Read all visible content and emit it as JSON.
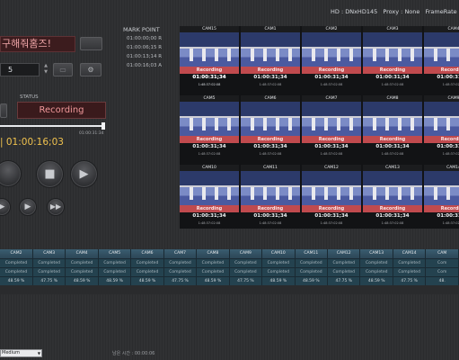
{
  "header": {
    "format": "HD : DNxHD145",
    "proxy": "Proxy : None",
    "framerate": "FrameRate : 60M"
  },
  "title_field": {
    "value": "구해줘홈즈!"
  },
  "count_field": {
    "value": "5"
  },
  "status": {
    "label": "STATUS",
    "value": "Recording"
  },
  "progress": {
    "fraction": 0.97,
    "time": "01:00:31:34"
  },
  "timecode": "| 01:00:16;03",
  "mark_point": {
    "title": "MARK POINT",
    "items": [
      "01:00:00;00 R",
      "01:00:06;15 R",
      "01:00:13;14 R",
      "01:00:16;03 A"
    ]
  },
  "cameras": [
    {
      "name": "PGM",
      "status": "Recording",
      "tc": "01:00:31;34",
      "sub": "1:48:37:02:08"
    },
    {
      "name": "CAM1",
      "status": "Recording",
      "tc": "01:00:31;34",
      "sub": "1:48:37:02:08"
    },
    {
      "name": "CAM2",
      "status": "Recording",
      "tc": "01:00:31;34",
      "sub": "1:48:37:02:08"
    },
    {
      "name": "CAM3",
      "status": "Recording",
      "tc": "01:00:31;34",
      "sub": "1:48:37:02:08"
    },
    {
      "name": "CAM4",
      "status": "Recording",
      "tc": "01:00:31;34",
      "sub": "1:48:37:02:08"
    },
    {
      "name": "CAM5",
      "status": "Recording",
      "tc": "01:00:31;34",
      "sub": "1:48:37:02:08"
    },
    {
      "name": "CAM6",
      "status": "Recording",
      "tc": "01:00:31;34",
      "sub": "1:48:37:02:08"
    },
    {
      "name": "CAM7",
      "status": "Recording",
      "tc": "01:00:31;34",
      "sub": "1:48:37:02:08"
    },
    {
      "name": "CAM8",
      "status": "Recording",
      "tc": "01:00:31;34",
      "sub": "1:48:37:02:08"
    },
    {
      "name": "CAM9",
      "status": "Recording",
      "tc": "01:00:31;34",
      "sub": "1:48:37:02:08"
    },
    {
      "name": "CAM10",
      "status": "Recording",
      "tc": "01:00:31;34",
      "sub": "1:48:37:02:08"
    },
    {
      "name": "CAM11",
      "status": "Recording",
      "tc": "01:00:31;34",
      "sub": "1:48:37:02:08"
    },
    {
      "name": "CAM12",
      "status": "Recording",
      "tc": "01:00:31;34",
      "sub": "1:48:37:02:08"
    },
    {
      "name": "CAM13",
      "status": "Recording",
      "tc": "01:00:31;34",
      "sub": "1:48:37:02:08"
    },
    {
      "name": "CAM14",
      "status": "Recording",
      "tc": "01:00:31;34",
      "sub": "1:48:37:02:08"
    },
    {
      "name": "CAM15",
      "status": "Recording",
      "tc": "01:00:31;34",
      "sub": "1:48:37:02:08"
    }
  ],
  "table": {
    "headers": [
      "CAM2",
      "CAM3",
      "CAM4",
      "CAM5",
      "CAM6",
      "CAM7",
      "CAM8",
      "CAM9",
      "CAM10",
      "CAM11",
      "CAM12",
      "CAM13",
      "CAM14",
      "CAM"
    ],
    "rows": [
      [
        "Completed",
        "Completed",
        "Completed",
        "Completed",
        "Completed",
        "Completed",
        "Completed",
        "Completed",
        "Completed",
        "Completed",
        "Completed",
        "Completed",
        "Completed",
        "Com"
      ],
      [
        "Completed",
        "Completed",
        "Completed",
        "Completed",
        "Completed",
        "Completed",
        "Completed",
        "Completed",
        "Completed",
        "Completed",
        "Completed",
        "Completed",
        "Completed",
        "Com"
      ],
      [
        "48.59 %",
        "47.75 %",
        "48.59 %",
        "48.59 %",
        "48.59 %",
        "47.75 %",
        "48.59 %",
        "47.75 %",
        "48.59 %",
        "48.59 %",
        "47.75 %",
        "48.59 %",
        "47.75 %",
        "48."
      ]
    ]
  },
  "footer": {
    "quality": "Medium",
    "remaining": "남은 시간 : 00:00:06"
  },
  "icons": {
    "title_button": "blank-button",
    "icon_btn_1": "folder-icon",
    "icon_btn_2": "settings-file-icon",
    "transport": [
      "record-icon",
      "stop-icon",
      "play-icon",
      "prev-icon",
      "next-icon",
      "fast-forward-icon"
    ]
  },
  "colors": {
    "recording": "#c04a4e",
    "timecode": "#f0c24e",
    "table_header": "#3a5d70"
  }
}
